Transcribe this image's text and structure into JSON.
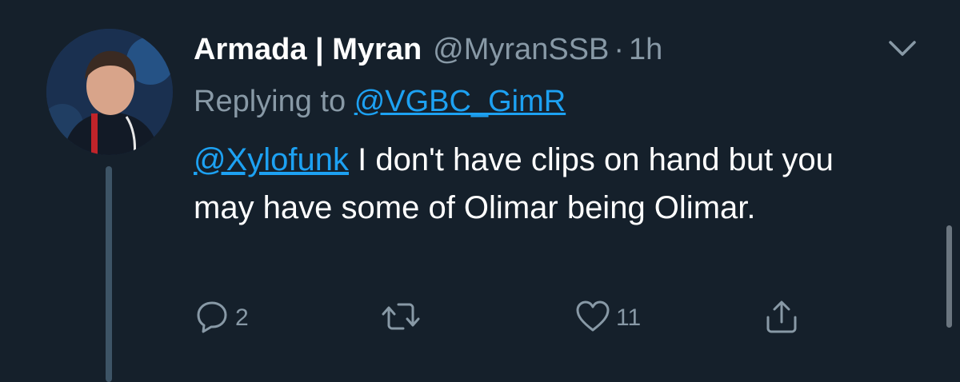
{
  "tweet": {
    "display_name": "Armada | Myran",
    "handle": "@MyranSSB",
    "separator": "·",
    "time": "1h",
    "replying_prefix": "Replying to",
    "replying_to": "@VGBC_GimR",
    "mention": "@Xylofunk",
    "text": " I don't have clips on hand but you may have some of Olimar being Olimar.",
    "actions": {
      "reply_count": "2",
      "like_count": "11"
    }
  },
  "icons": {
    "caret": "chevron-down-icon",
    "reply": "reply-icon",
    "retweet": "retweet-icon",
    "like": "heart-icon",
    "share": "share-icon"
  },
  "colors": {
    "background": "#15202b",
    "secondary_text": "#8899a6",
    "link": "#1da1f2"
  }
}
